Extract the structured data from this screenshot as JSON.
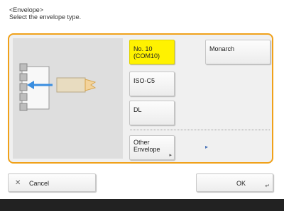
{
  "header": {
    "title": "<Envelope>",
    "subtitle": "Select the envelope type."
  },
  "options": {
    "no10": "No. 10 (COM10)",
    "monarch": "Monarch",
    "iso_c5": "ISO-C5",
    "dl": "DL",
    "other_line1": "Other",
    "other_line2": "Envelope"
  },
  "selected_option": "No. 10 (COM10)",
  "footer": {
    "cancel_label": "Cancel",
    "ok_label": "OK"
  },
  "icons": {
    "cancel": "close-icon",
    "ok": "enter-icon",
    "other_envelope": "submenu-icon",
    "illustration_arrow": "arrow-left-icon"
  },
  "colors": {
    "accent": "#f0a11a",
    "selected": "#fff200",
    "arrow": "#3a8ee0"
  }
}
